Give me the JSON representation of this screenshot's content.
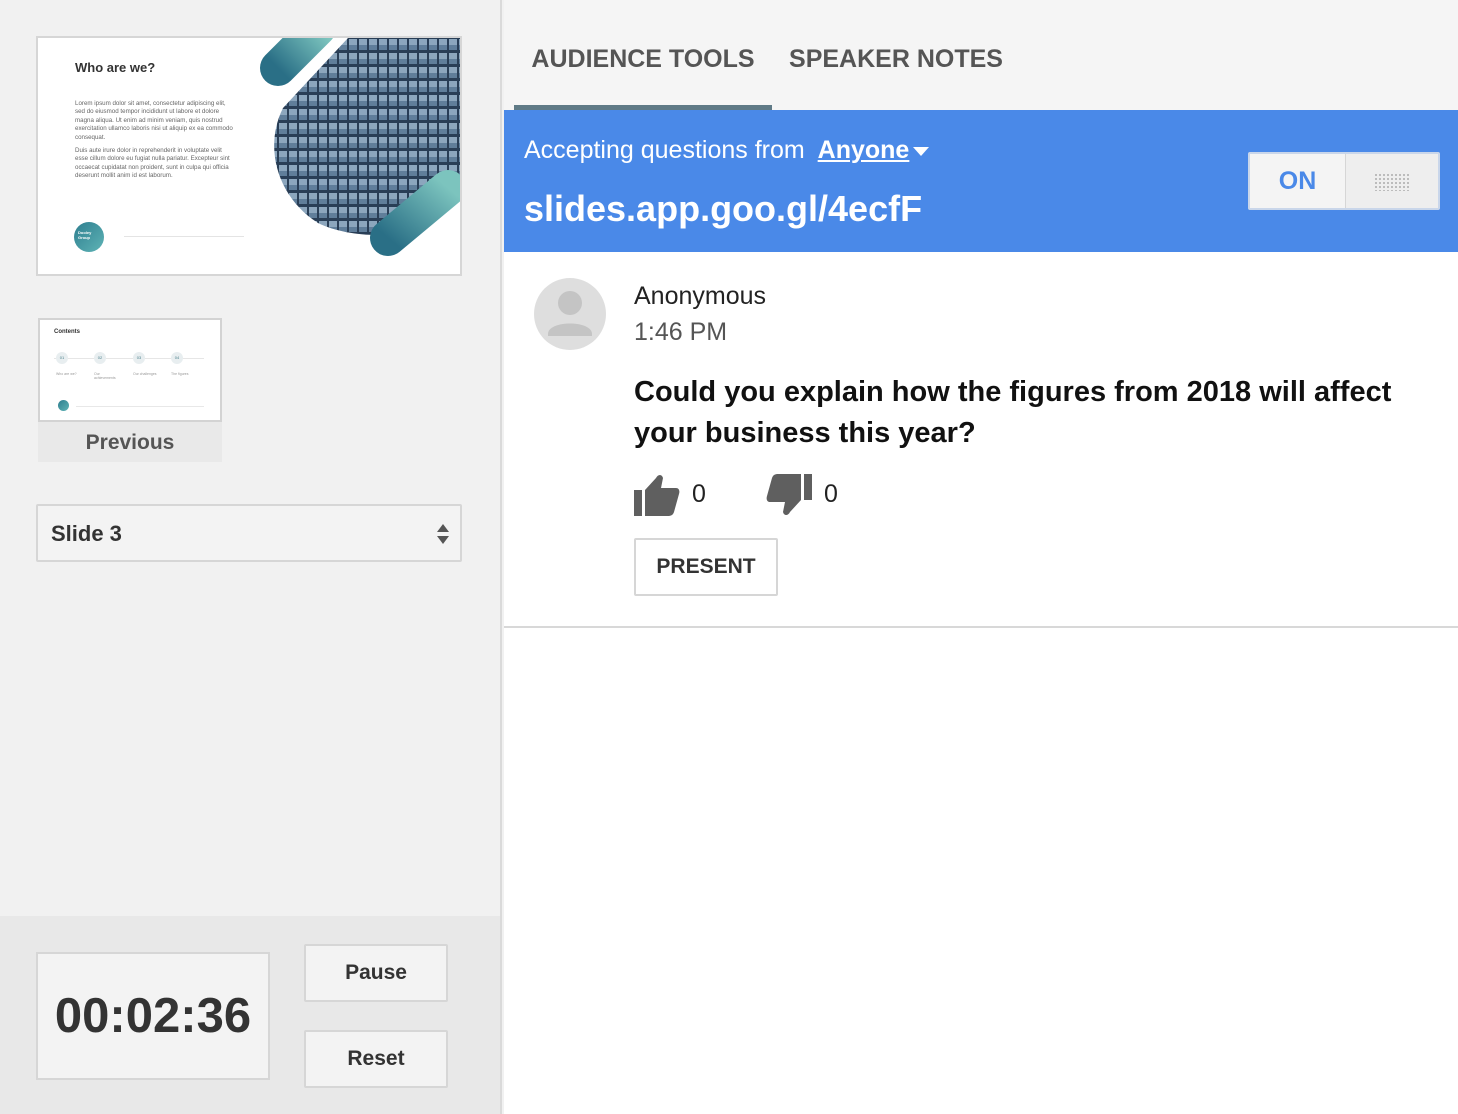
{
  "current_slide": {
    "title": "Who are we?",
    "paragraph_1": "Lorem ipsum dolor sit amet, consectetur adipiscing elit, sed do eiusmod tempor incididunt ut labore et dolore magna aliqua. Ut enim ad minim veniam, quis nostrud exercitation ullamco laboris nisi ut aliquip ex ea commodo consequat.",
    "paragraph_2": "Duis aute irure dolor in reprehenderit in voluptate velit esse cillum dolore eu fugiat nulla pariatur. Excepteur sint occaecat cupidatat non proident, sunt in culpa qui officia deserunt mollit anim id est laborum.",
    "logo_text": "Dooley Group"
  },
  "previous_slide": {
    "thumb_title": "Contents",
    "items": [
      {
        "num": "01",
        "caption": "Who are we?"
      },
      {
        "num": "02",
        "caption": "Our achievements"
      },
      {
        "num": "03",
        "caption": "Our challenges"
      },
      {
        "num": "04",
        "caption": "The figures"
      }
    ],
    "label": "Previous"
  },
  "slide_select": {
    "value": "Slide 3"
  },
  "timer": {
    "value": "00:02:36",
    "pause_label": "Pause",
    "reset_label": "Reset"
  },
  "tabs": [
    {
      "label": "AUDIENCE TOOLS",
      "active": true
    },
    {
      "label": "SPEAKER NOTES",
      "active": false
    }
  ],
  "banner": {
    "accepting_label": "Accepting questions from",
    "accepting_from": "Anyone",
    "url": "slides.app.goo.gl/4ecfF",
    "toggle_label": "ON",
    "color": "#4a89e8"
  },
  "question": {
    "author": "Anonymous",
    "time": "1:46 PM",
    "text": "Could you explain how the figures from 2018 will affect your business this year?",
    "upvotes": "0",
    "downvotes": "0",
    "present_label": "PRESENT"
  }
}
